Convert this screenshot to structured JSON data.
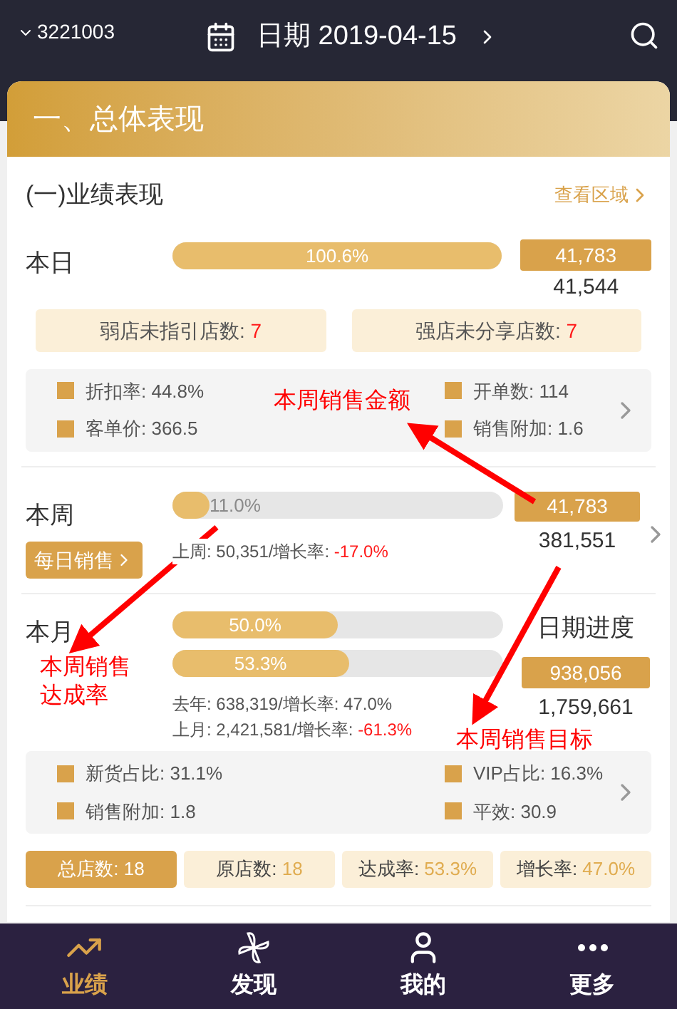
{
  "header": {
    "store": "3221003",
    "date": "日期 2019-04-15"
  },
  "section": {
    "title": "一、总体表现",
    "subtitle": "(一)业绩表现",
    "link": "查看区域"
  },
  "day": {
    "label": "本日",
    "level": 1.0,
    "percent": "100.6%",
    "amount": "41,783",
    "target": "41,544"
  },
  "day_tags": [
    {
      "label": "弱店未指引店数: ",
      "value": "7"
    },
    {
      "label": "强店未分享店数: ",
      "value": "7"
    }
  ],
  "day_metrics": [
    {
      "text": "折扣率: 44.8%"
    },
    {
      "text": "开单数: 114"
    },
    {
      "text": "客单价: 366.5"
    },
    {
      "text": "销售附加: 1.6"
    }
  ],
  "week": {
    "label": "本周",
    "button": "每日销售",
    "level": 0.11,
    "percent": "11.0%",
    "stat": {
      "label": "上周: 50,351/增长率: ",
      "value": "-17.0%",
      "negative": true
    },
    "amount": "41,783",
    "target": "381,551"
  },
  "month": {
    "label": "本月",
    "bars": [
      {
        "level": 0.5,
        "percent": "50.0%"
      },
      {
        "level": 0.533,
        "percent": "53.3%"
      }
    ],
    "stats": [
      {
        "label": "去年: 638,319/增长率: ",
        "value": "47.0%",
        "negative": false
      },
      {
        "label": "上月: 2,421,581/增长率: ",
        "value": "-61.3%",
        "negative": true
      }
    ],
    "progress_label": "日期进度",
    "amount": "938,056",
    "target": "1,759,661"
  },
  "month_metrics": [
    {
      "text": "新货占比: 31.1%"
    },
    {
      "text": "VIP占比: 16.3%"
    },
    {
      "text": "销售附加: 1.8"
    },
    {
      "text": "平效: 30.9"
    }
  ],
  "summary_tabs": [
    {
      "label": "总店数: ",
      "value": "18",
      "selected": true
    },
    {
      "label": "原店数: ",
      "value": "18",
      "selected": false
    },
    {
      "label": "达成率: ",
      "value": "53.3%",
      "selected": false
    },
    {
      "label": "增长率: ",
      "value": "47.0%",
      "selected": false
    }
  ],
  "annotations": [
    {
      "text": "本周销售金额"
    },
    {
      "text": "本周销售达成率"
    },
    {
      "text": "本周销售目标"
    }
  ],
  "nav": [
    {
      "label": "业绩",
      "kind": "chart",
      "selected": true
    },
    {
      "label": "发现",
      "kind": "pinwheel",
      "selected": false
    },
    {
      "label": "我的",
      "kind": "person",
      "selected": false
    },
    {
      "label": "更多",
      "kind": "more",
      "selected": false
    }
  ]
}
